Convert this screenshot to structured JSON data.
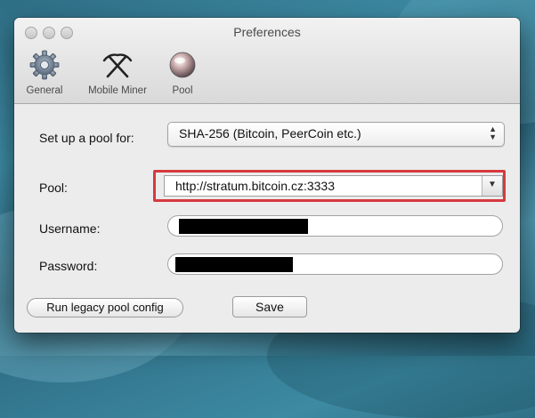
{
  "window": {
    "title": "Preferences"
  },
  "toolbar": {
    "items": [
      {
        "label": "General",
        "icon": "gear-icon"
      },
      {
        "label": "Mobile Miner",
        "icon": "pickaxe-icon"
      },
      {
        "label": "Pool",
        "icon": "pool-sphere-icon"
      }
    ]
  },
  "form": {
    "setup_label": "Set up a pool for:",
    "setup_value": "SHA-256 (Bitcoin, PeerCoin etc.)",
    "pool_label": "Pool:",
    "pool_value": "http://stratum.bitcoin.cz:3333",
    "username_label": "Username:",
    "password_label": "Password:"
  },
  "buttons": {
    "legacy": "Run legacy pool config",
    "save": "Save"
  },
  "colors": {
    "highlight": "#d6393f",
    "window_bg": "#ececec"
  }
}
